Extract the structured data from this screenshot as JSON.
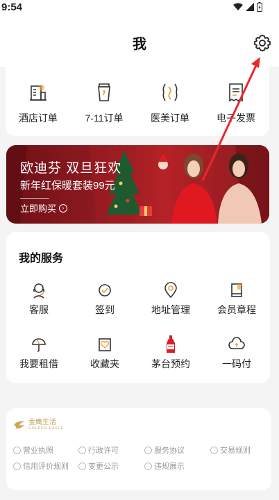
{
  "status": {
    "time": "9:54"
  },
  "header": {
    "title": "我"
  },
  "orders": [
    {
      "label": "酒店订单",
      "icon": "hotel-icon"
    },
    {
      "label": "7-11订单",
      "icon": "cup-icon"
    },
    {
      "label": "医美订单",
      "icon": "beauty-icon"
    },
    {
      "label": "电子发票",
      "icon": "invoice-icon"
    }
  ],
  "banner": {
    "title": "欧迪芬 双旦狂欢",
    "subtitle": "新年红保暖套装99元",
    "cta": "立即购买"
  },
  "services": {
    "title": "我的服务",
    "items": [
      {
        "label": "客服",
        "icon": "customer-service-icon"
      },
      {
        "label": "签到",
        "icon": "check-in-icon"
      },
      {
        "label": "地址管理",
        "icon": "location-icon"
      },
      {
        "label": "会员章程",
        "icon": "book-icon"
      },
      {
        "label": "我要租借",
        "icon": "umbrella-icon"
      },
      {
        "label": "收藏夹",
        "icon": "favorites-icon"
      },
      {
        "label": "茅台预约",
        "icon": "bottle-icon"
      },
      {
        "label": "一码付",
        "icon": "cloud-pay-icon"
      }
    ]
  },
  "footer": {
    "brand": "金鹰生活",
    "brand_sub": "GOLDEN EAGLE",
    "links": [
      {
        "label": "营业执照"
      },
      {
        "label": "行政许可"
      },
      {
        "label": "服务协议"
      },
      {
        "label": "交易规则"
      },
      {
        "label": "信用评价规则"
      },
      {
        "label": "变更公示"
      },
      {
        "label": "违规展示"
      }
    ]
  },
  "colors": {
    "accent": "#e8292e",
    "banner_red": "#9a1c21",
    "brand_gold": "#c8a25e",
    "background": "#f4f4f4"
  }
}
